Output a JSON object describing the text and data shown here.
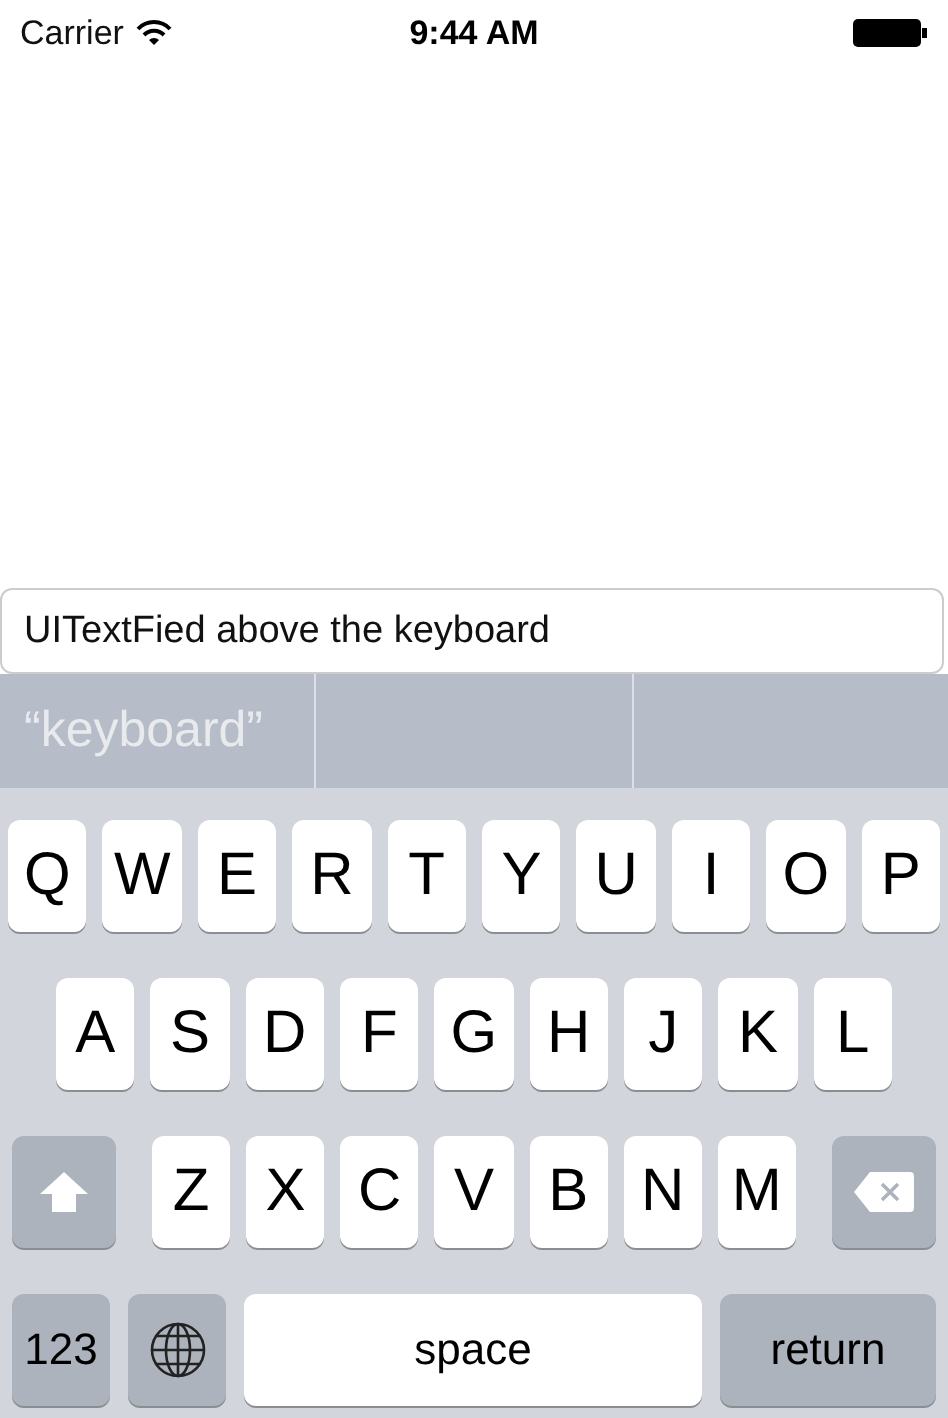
{
  "status_bar": {
    "carrier": "Carrier",
    "time": "9:44 AM"
  },
  "text_field": {
    "value": "UITextFied above the keyboard"
  },
  "suggestions": [
    "“keyboard”"
  ],
  "keyboard": {
    "rows": [
      [
        "Q",
        "W",
        "E",
        "R",
        "T",
        "Y",
        "U",
        "I",
        "O",
        "P"
      ],
      [
        "A",
        "S",
        "D",
        "F",
        "G",
        "H",
        "J",
        "K",
        "L"
      ],
      [
        "Z",
        "X",
        "C",
        "V",
        "B",
        "N",
        "M"
      ]
    ],
    "numbers_key": "123",
    "space_key": "space",
    "return_key": "return"
  }
}
